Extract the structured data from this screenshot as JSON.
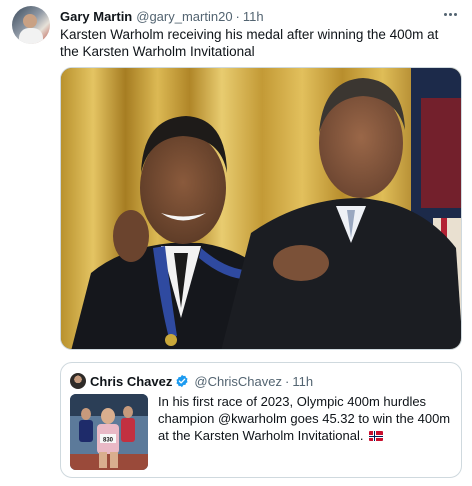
{
  "tweet": {
    "display_name": "Gary Martin",
    "handle": "@gary_martin20",
    "separator": "·",
    "time": "11h",
    "text": "Karsten Warholm receiving his medal after winning the 400m at the Karsten Warholm Invitational"
  },
  "quoted_tweet": {
    "display_name": "Chris Chavez",
    "handle": "@ChrisChavez",
    "separator": "·",
    "time": "11h",
    "text": "In his first race of 2023, Olympic 400m hurdles champion @kwarholm goes 45.32 to win the 400m at the Karsten Warholm Invitational.",
    "bib_number": "830"
  },
  "icons": {
    "more": "more-horizontal-icon",
    "verified": "verified-badge-icon",
    "flag": "norway-flag-emoji"
  },
  "colors": {
    "text_primary": "#0f1419",
    "text_secondary": "#536471",
    "border": "#cfd9de",
    "verified_blue": "#1d9bf0"
  }
}
